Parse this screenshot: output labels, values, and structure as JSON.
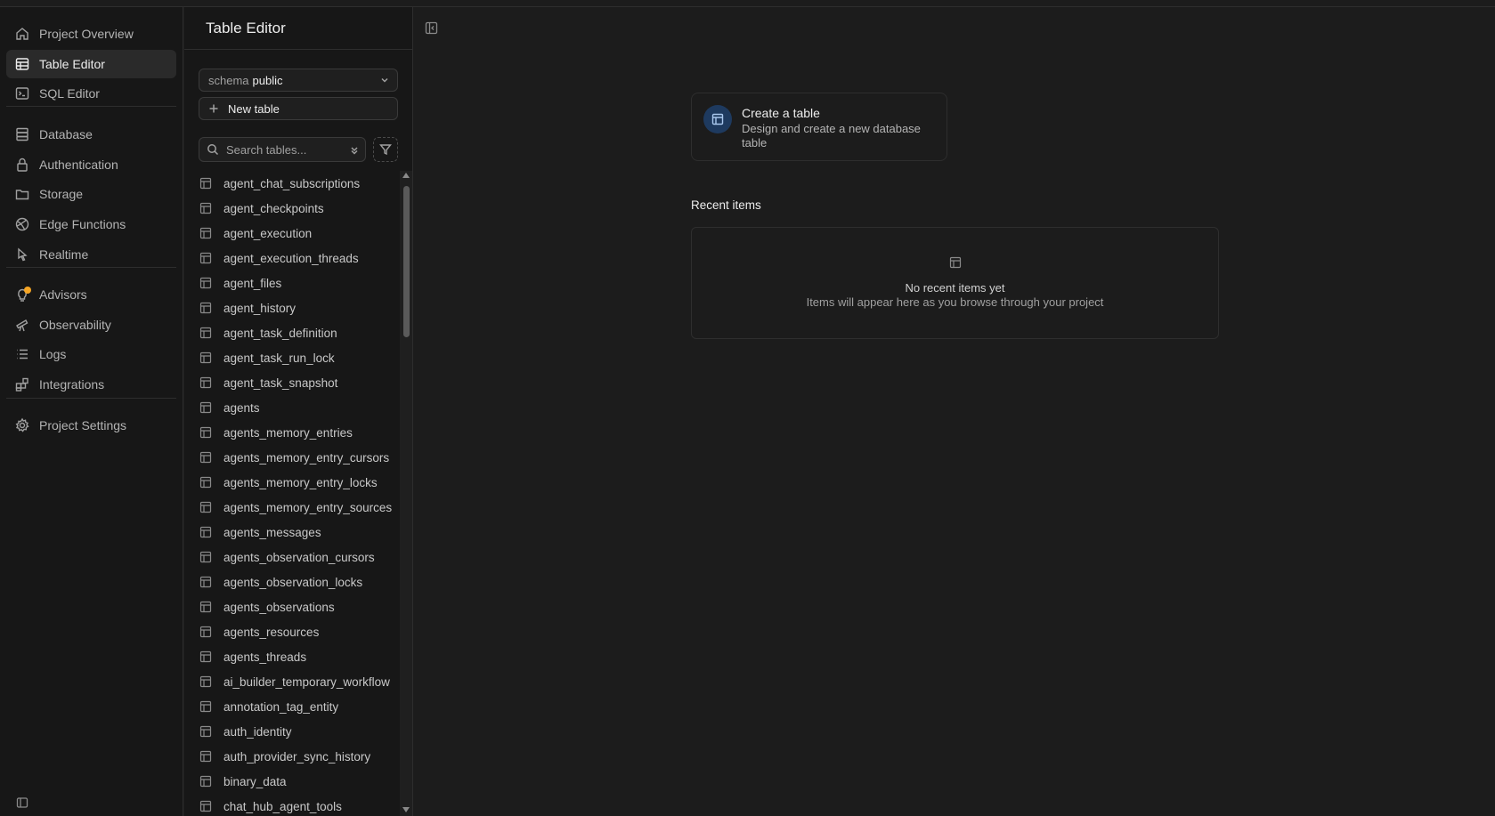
{
  "nav": {
    "items": [
      {
        "label": "Project Overview",
        "icon": "home-icon"
      },
      {
        "label": "Table Editor",
        "icon": "table-icon",
        "active": true
      },
      {
        "label": "SQL Editor",
        "icon": "terminal-icon"
      },
      {
        "label": "Database",
        "icon": "database-icon"
      },
      {
        "label": "Authentication",
        "icon": "lock-icon"
      },
      {
        "label": "Storage",
        "icon": "folder-icon"
      },
      {
        "label": "Edge Functions",
        "icon": "globe-icon"
      },
      {
        "label": "Realtime",
        "icon": "cursor-icon"
      },
      {
        "label": "Advisors",
        "icon": "lightbulb-icon"
      },
      {
        "label": "Observability",
        "icon": "telescope-icon"
      },
      {
        "label": "Logs",
        "icon": "list-icon"
      },
      {
        "label": "Integrations",
        "icon": "blocks-icon"
      },
      {
        "label": "Project Settings",
        "icon": "gear-icon"
      }
    ],
    "advisor_dot_color": "#f5a524"
  },
  "panel": {
    "title": "Table Editor",
    "schema_label": "schema",
    "schema_value": "public",
    "new_table_label": "New table",
    "search_placeholder": "Search tables...",
    "tables": [
      "agent_chat_subscriptions",
      "agent_checkpoints",
      "agent_execution",
      "agent_execution_threads",
      "agent_files",
      "agent_history",
      "agent_task_definition",
      "agent_task_run_lock",
      "agent_task_snapshot",
      "agents",
      "agents_memory_entries",
      "agents_memory_entry_cursors",
      "agents_memory_entry_locks",
      "agents_memory_entry_sources",
      "agents_messages",
      "agents_observation_cursors",
      "agents_observation_locks",
      "agents_observations",
      "agents_resources",
      "agents_threads",
      "ai_builder_temporary_workflow",
      "annotation_tag_entity",
      "auth_identity",
      "auth_provider_sync_history",
      "binary_data",
      "chat_hub_agent_tools"
    ]
  },
  "main": {
    "create_card": {
      "title": "Create a table",
      "description": "Design and create a new database table"
    },
    "recent": {
      "title": "Recent items",
      "empty_title": "No recent items yet",
      "empty_description": "Items will appear here as you browse through your project"
    },
    "accent_badge_color": "#1e3a5f"
  }
}
